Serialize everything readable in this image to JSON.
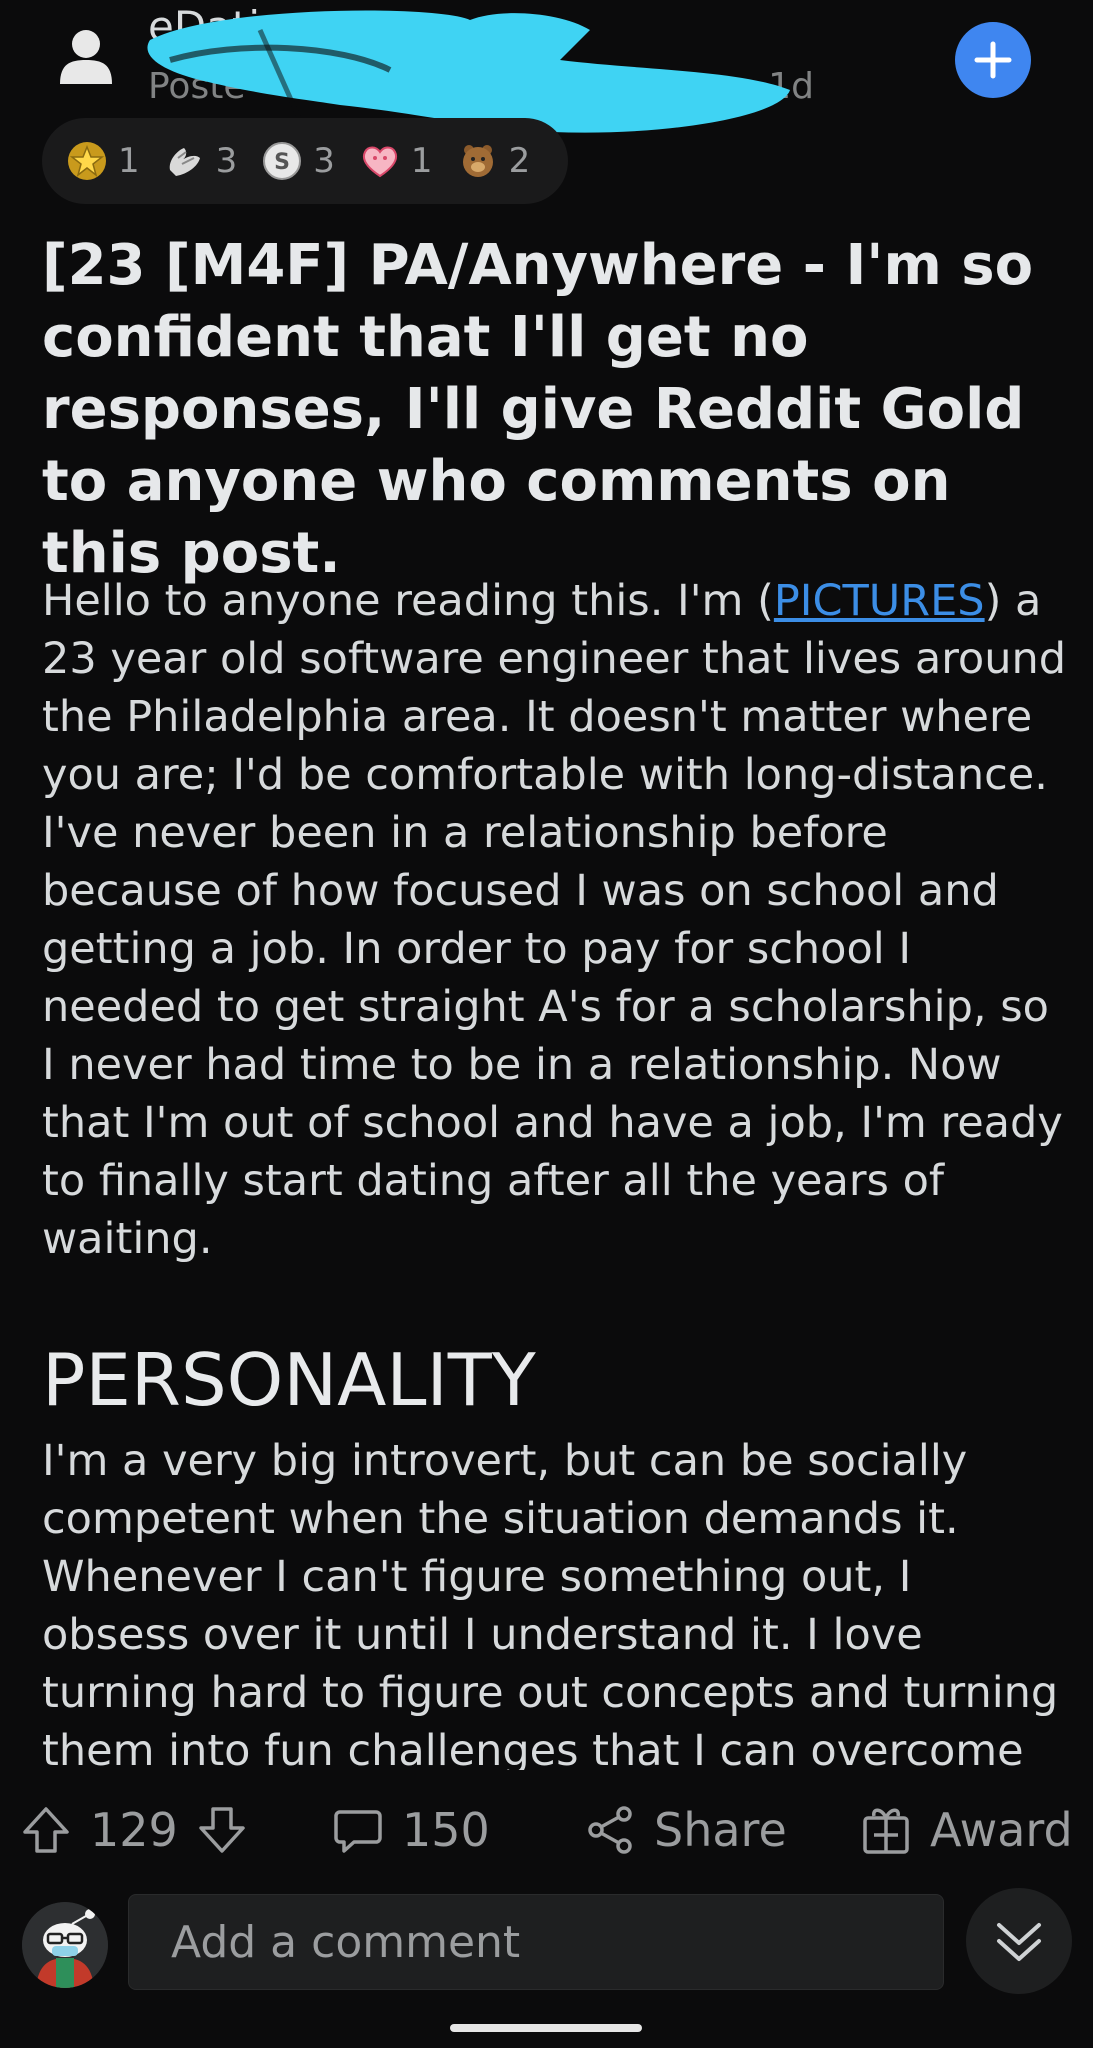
{
  "header": {
    "subreddit_visible": "eDating",
    "posted_prefix": "Poste",
    "posted_age": "• 1d",
    "join_icon": "plus-icon",
    "redaction_color": "#3fd3f3"
  },
  "awards": [
    {
      "icon": "star-award-icon",
      "count": "1"
    },
    {
      "icon": "hands-award-icon",
      "count": "3"
    },
    {
      "icon": "silver-coin-award-icon",
      "count": "3"
    },
    {
      "icon": "heart-award-icon",
      "count": "1"
    },
    {
      "icon": "bear-award-icon",
      "count": "2"
    }
  ],
  "post": {
    "title": "[23 [M4F] PA/Anywhere - I'm so confident that I'll get no responses, I'll give Reddit Gold to anyone who comments on this post.",
    "body_intro_before": "Hello to anyone reading this. I'm (",
    "body_link": "PICTURES",
    "body_intro_after": ") a 23 year old software engineer that lives around the Philadelphia area. It doesn't matter where you are; I'd be comfortable with long-distance. I've never been in a relationship before because of how focused I was on school and getting a job. In order to pay for school I needed to get straight A's for a scholarship, so I never had time to be in a relationship. Now that I'm out of school and have a job, I'm ready to finally start dating after all the years of waiting.",
    "section_heading": "PERSONALITY",
    "section_text": "I'm a very big introvert, but can be socially competent when the situation demands it. Whenever I can't figure something out, I obsess over it until I understand it. I love turning hard to figure out concepts and turning them into fun challenges that I can overcome"
  },
  "actions": {
    "votes": "129",
    "comments": "150",
    "share_label": "Share",
    "award_label": "Award"
  },
  "comment_bar": {
    "placeholder": "Add a comment"
  },
  "colors": {
    "background": "#0b0b0c",
    "accent_blue": "#3f86f0",
    "link": "#3c8ee6"
  }
}
